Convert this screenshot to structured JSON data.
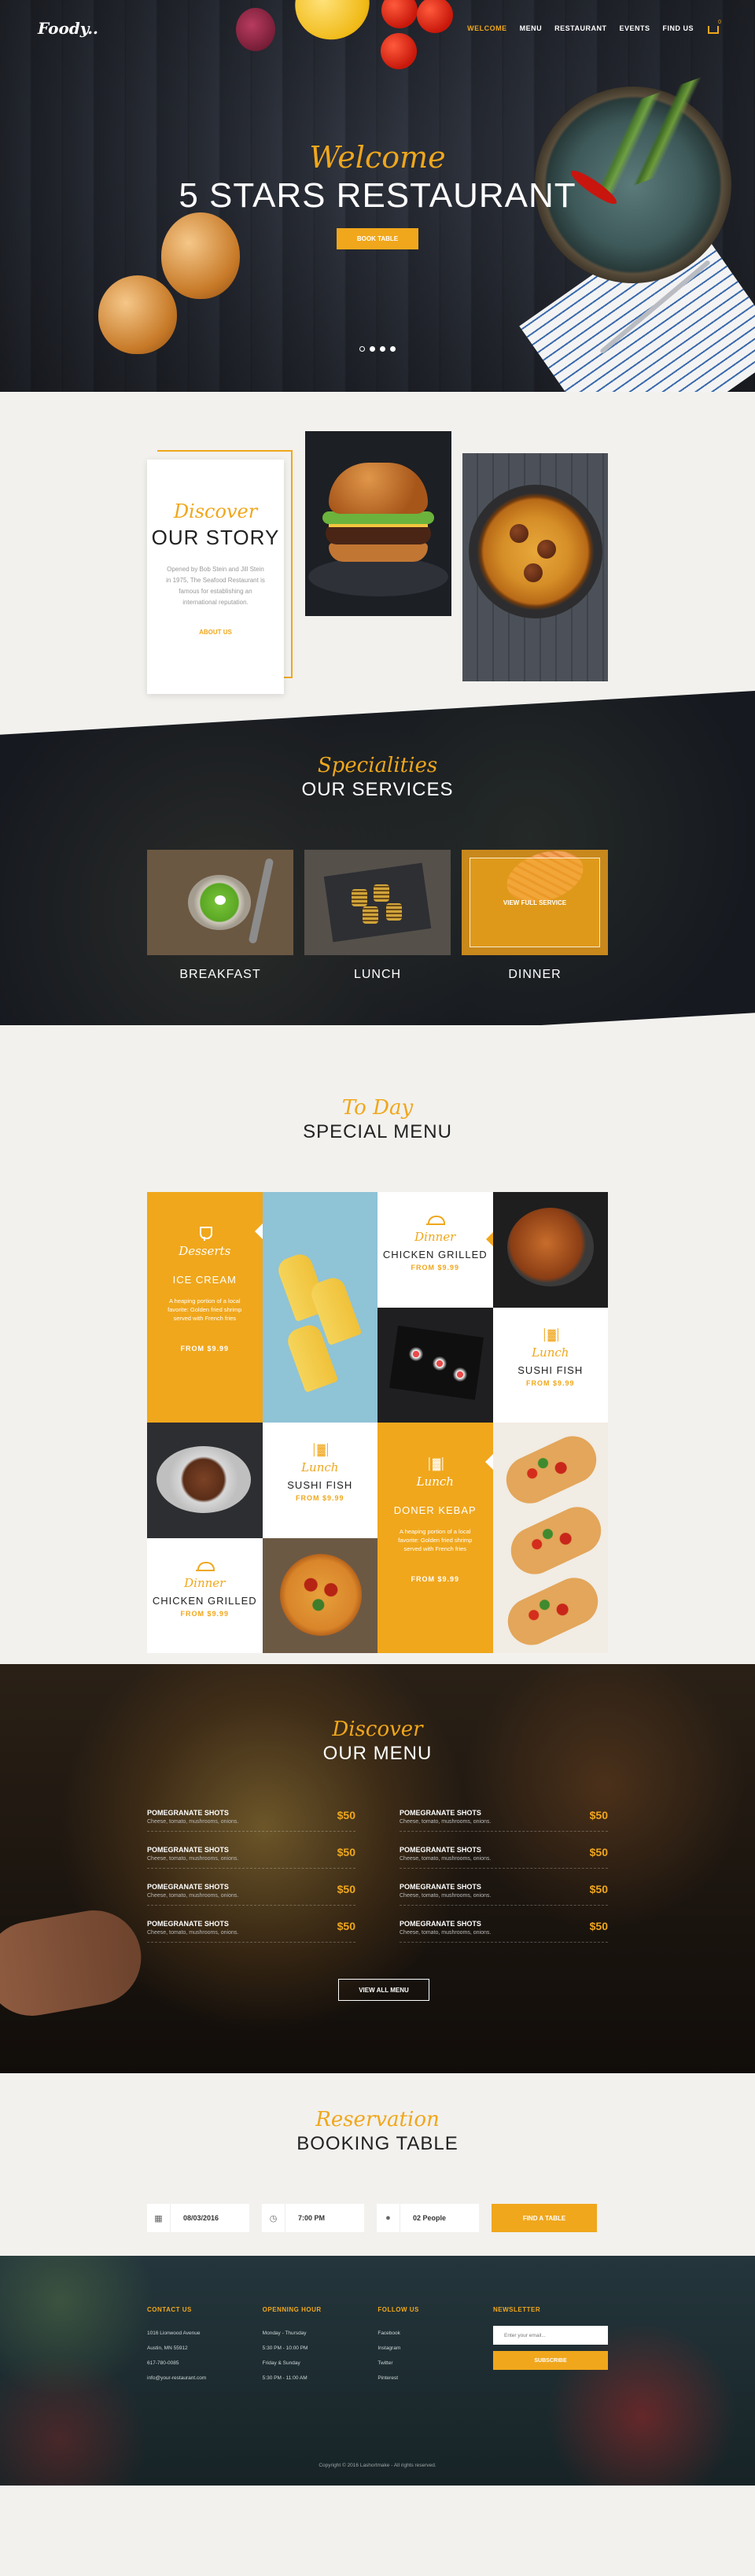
{
  "brand": {
    "logo": "Foody.."
  },
  "nav": {
    "items": [
      "WELCOME",
      "MENU",
      "RESTAURANT",
      "EVENTS",
      "FIND US"
    ],
    "active": "WELCOME",
    "cart_count": "0"
  },
  "hero": {
    "script": "Welcome",
    "title": "5 STARS RESTAURANT",
    "button": "BOOK TABLE",
    "slides": 4,
    "active_slide": 1
  },
  "story": {
    "script": "Discover",
    "title": "OUR STORY",
    "text": "Opened by Bob Stein and Jill Stein in 1975, The Seafood Restaurant is famous for establishing an international reputation.",
    "link": "ABOUT US"
  },
  "services": {
    "script": "Specialities",
    "title": "OUR SERVICES",
    "items": [
      {
        "label": "BREAKFAST",
        "icon": "soup-bowl"
      },
      {
        "label": "LUNCH",
        "icon": "grilled-food"
      },
      {
        "label": "DINNER",
        "icon": "salmon",
        "overlay": "VIEW FULL SERVICE"
      }
    ]
  },
  "special": {
    "script": "To Day",
    "title": "SPECIAL MENU",
    "items": {
      "ice_cream": {
        "category": "Desserts",
        "name": "ICE CREAM",
        "desc": "A heaping portion of a local favorite: Golden fried shrimp served with French fries",
        "price": "FROM $9.99"
      },
      "chicken_1": {
        "category": "Dinner",
        "name": "CHICKEN GRILLED",
        "price": "FROM $9.99"
      },
      "sushi_1": {
        "category": "Lunch",
        "name": "SUSHI FISH",
        "price": "FROM $9.99"
      },
      "sushi_2": {
        "category": "Lunch",
        "name": "SUSHI FISH",
        "price": "FROM $9.99"
      },
      "doner": {
        "category": "Lunch",
        "name": "DONER KEBAP",
        "desc": "A heaping portion of a local favorite: Golden fried shrimp served with French fries",
        "price": "FROM $9.99"
      },
      "chicken_2": {
        "category": "Dinner",
        "name": "CHICKEN GRILLED",
        "price": "FROM $9.99"
      }
    }
  },
  "ourmenu": {
    "script": "Discover",
    "title": "OUR MENU",
    "items": [
      {
        "name": "POMEGRANATE SHOTS",
        "desc": "Cheese, tomato, mushrooms, onions.",
        "price": "$50"
      },
      {
        "name": "POMEGRANATE SHOTS",
        "desc": "Cheese, tomato, mushrooms, onions.",
        "price": "$50"
      },
      {
        "name": "POMEGRANATE SHOTS",
        "desc": "Cheese, tomato, mushrooms, onions.",
        "price": "$50"
      },
      {
        "name": "POMEGRANATE SHOTS",
        "desc": "Cheese, tomato, mushrooms, onions.",
        "price": "$50"
      },
      {
        "name": "POMEGRANATE SHOTS",
        "desc": "Cheese, tomato, mushrooms, onions.",
        "price": "$50"
      },
      {
        "name": "POMEGRANATE SHOTS",
        "desc": "Cheese, tomato, mushrooms, onions.",
        "price": "$50"
      },
      {
        "name": "POMEGRANATE SHOTS",
        "desc": "Cheese, tomato, mushrooms, onions.",
        "price": "$50"
      },
      {
        "name": "POMEGRANATE SHOTS",
        "desc": "Cheese, tomato, mushrooms, onions.",
        "price": "$50"
      }
    ],
    "button": "VIEW ALL MENU"
  },
  "booking": {
    "script": "Reservation",
    "title": "BOOKING TABLE",
    "date": "08/03/2016",
    "time": "7:00 PM",
    "people": "02 People",
    "button": "FIND A TABLE"
  },
  "footer": {
    "contact": {
      "title": "CONTACT US",
      "lines": [
        "1016 Lionwood Avenue",
        "Austin, MN 55912",
        "617-780-0085",
        "info@your-restaurant.com"
      ]
    },
    "hours": {
      "title": "OPENNING HOUR",
      "lines": [
        "Monday - Thursday",
        "5:30 PM - 10:00 PM",
        "Friday & Sunday",
        "5:30 PM - 11:00 AM"
      ]
    },
    "follow": {
      "title": "FOLLOW US",
      "lines": [
        "Facebook",
        "Instagram",
        "Twitter",
        "Pinterest"
      ]
    },
    "newsletter": {
      "title": "NEWSLETTER",
      "placeholder": "Enter your email...",
      "button": "SUBSCRIBE"
    },
    "copyright": "Copyright © 2016 Lashortmake - All rights reserved."
  },
  "colors": {
    "accent": "#f0a71c",
    "dark": "#16191f",
    "light_bg": "#f2f1ee"
  }
}
